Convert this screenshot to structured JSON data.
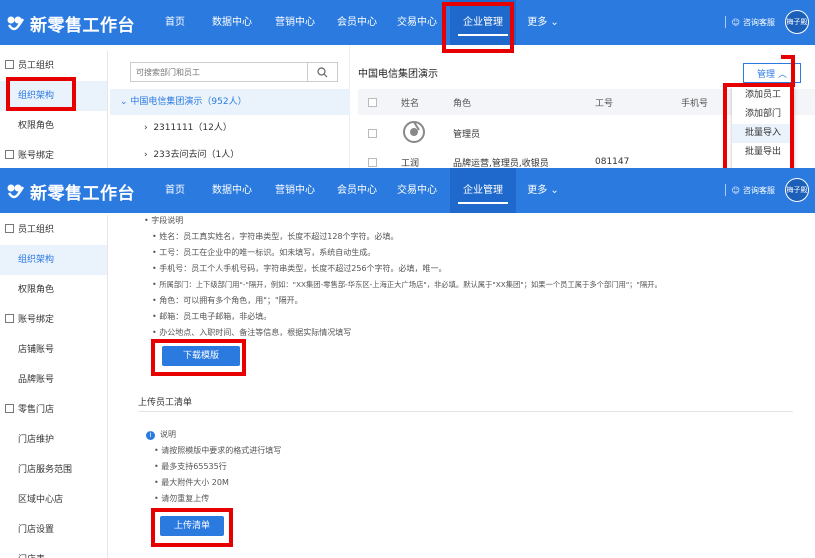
{
  "app": {
    "title": "新零售工作台"
  },
  "nav": {
    "items": [
      "首页",
      "数据中心",
      "营销中心",
      "会员中心",
      "交易中心",
      "企业管理",
      "更多"
    ],
    "support": "咨询客服",
    "user": "梅子殿"
  },
  "sidebar_top": [
    {
      "label": "员工组织",
      "group": true
    },
    {
      "label": "组织架构",
      "selected": true
    },
    {
      "label": "权限角色"
    },
    {
      "label": "账号绑定",
      "group": true
    }
  ],
  "sidebar_bottom": [
    {
      "label": "员工组织",
      "group": true
    },
    {
      "label": "组织架构",
      "selected": true
    },
    {
      "label": "权限角色"
    },
    {
      "label": "账号绑定",
      "group": true
    },
    {
      "label": "店铺账号"
    },
    {
      "label": "品牌账号"
    },
    {
      "label": "零售门店",
      "group": true
    },
    {
      "label": "门店维护"
    },
    {
      "label": "门店服务范围"
    },
    {
      "label": "区域中心店"
    },
    {
      "label": "门店设置"
    },
    {
      "label": "门店表"
    }
  ],
  "tree": {
    "search_placeholder": "可搜索部门和员工",
    "root": "中国电信集团演示（952人）",
    "children": [
      "2311111（12人）",
      "233去问去问（1人）"
    ]
  },
  "org": {
    "title": "中国电信集团演示",
    "manage_button": "管理",
    "columns": [
      "姓名",
      "角色",
      "工号",
      "手机号"
    ],
    "rows": [
      {
        "name": "",
        "role": "管理员",
        "id": "",
        "phone": ""
      },
      {
        "name": "工润",
        "role": "品牌运营,管理员,收银员",
        "id": "081147",
        "phone": ""
      }
    ]
  },
  "dropdown": {
    "items": [
      "添加员工",
      "添加部门",
      "批量导入",
      "批量导出"
    ],
    "highlight_index": 2
  },
  "fields_doc": {
    "heading": "字段说明",
    "items": [
      "姓名：员工真实姓名，字符串类型，长度不超过128个字符。必填。",
      "工号：员工在企业中的唯一标识。如未填写，系统自动生成。",
      "手机号：员工个人手机号码，字符串类型，长度不超过256个字符。必填，唯一。",
      "所属部门：上下级部门用\"-\"隔开，例如：\"XX集团-零售部-华东区-上海正大广场店\"，非必填。默认属于\"XX集团\"；如果一个员工属于多个部门用\"；\"隔开。",
      "角色：可以拥有多个角色，用\"；\"隔开。",
      "邮箱：员工电子邮箱，非必填。",
      "办公地点、入职时间、备注等信息，根据实际情况填写"
    ]
  },
  "download_button": "下载模版",
  "upload": {
    "section_title": "上传员工清单",
    "note_heading": "说明",
    "notes": [
      "请按照模版中要求的格式进行填写",
      "最多支持65535行",
      "最大附件大小 20M",
      "请勿重复上传"
    ],
    "button": "上传清单"
  },
  "colors": {
    "primary": "#2a7ae0",
    "highlight": "#e60000",
    "selected_bg": "#eaf2fc"
  }
}
